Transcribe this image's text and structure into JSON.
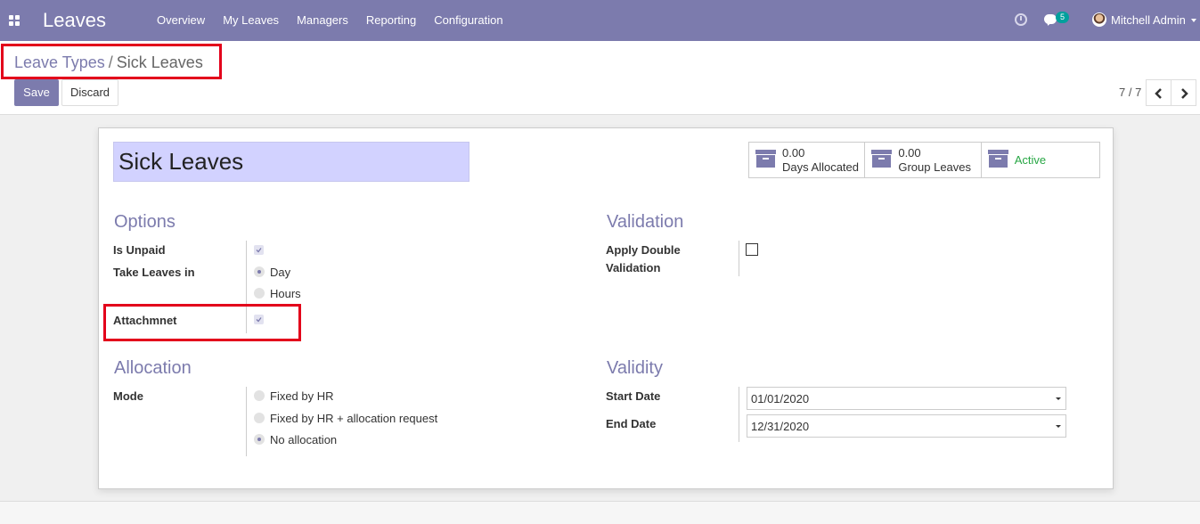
{
  "navbar": {
    "app_title": "Leaves",
    "menu": [
      "Overview",
      "My Leaves",
      "Managers",
      "Reporting",
      "Configuration"
    ],
    "chat_badge": "5",
    "user": "Mitchell Admin",
    "background": "#7c7bad"
  },
  "breadcrumb": {
    "parent": "Leave Types",
    "separator": "/",
    "current": "Sick Leaves"
  },
  "buttons": {
    "save": "Save",
    "discard": "Discard"
  },
  "pager": {
    "value": "7 / 7"
  },
  "form": {
    "name": "Sick Leaves",
    "smart_buttons": {
      "days_allocated": {
        "value": "0.00",
        "label": "Days Allocated"
      },
      "group_leaves": {
        "value": "0.00",
        "label": "Group Leaves"
      },
      "active": {
        "label": "Active"
      }
    },
    "options": {
      "title": "Options",
      "is_unpaid_label": "Is Unpaid",
      "is_unpaid": true,
      "take_leaves_label": "Take Leaves in",
      "take_leaves_options": [
        "Day",
        "Hours"
      ],
      "take_leaves_selected": "Day",
      "attachment_label": "Attachmnet",
      "attachment": true
    },
    "validation": {
      "title": "Validation",
      "double_validation_label_1": "Apply Double",
      "double_validation_label_2": "Validation",
      "double_validation": false
    },
    "allocation": {
      "title": "Allocation",
      "mode_label": "Mode",
      "mode_options": [
        "Fixed by HR",
        "Fixed by HR + allocation request",
        "No allocation"
      ],
      "mode_selected": "No allocation"
    },
    "validity": {
      "title": "Validity",
      "start_label": "Start Date",
      "start_value": "01/01/2020",
      "end_label": "End Date",
      "end_value": "12/31/2020"
    }
  },
  "colors": {
    "accent": "#7c7bad",
    "highlight": "#e3001b",
    "active_green": "#28a745"
  }
}
